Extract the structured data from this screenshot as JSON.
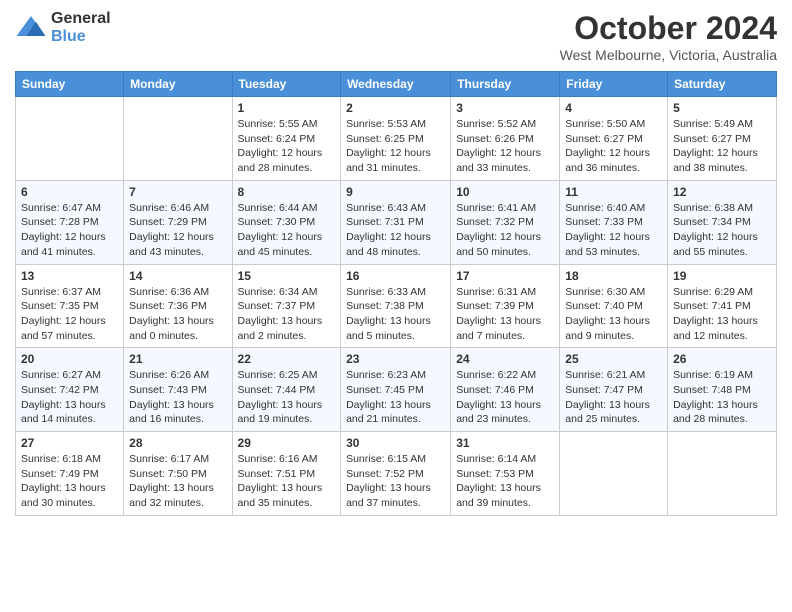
{
  "logo": {
    "general": "General",
    "blue": "Blue"
  },
  "title": "October 2024",
  "subtitle": "West Melbourne, Victoria, Australia",
  "days_of_week": [
    "Sunday",
    "Monday",
    "Tuesday",
    "Wednesday",
    "Thursday",
    "Friday",
    "Saturday"
  ],
  "weeks": [
    [
      {
        "day": "",
        "info": ""
      },
      {
        "day": "",
        "info": ""
      },
      {
        "day": "1",
        "info": "Sunrise: 5:55 AM\nSunset: 6:24 PM\nDaylight: 12 hours and 28 minutes."
      },
      {
        "day": "2",
        "info": "Sunrise: 5:53 AM\nSunset: 6:25 PM\nDaylight: 12 hours and 31 minutes."
      },
      {
        "day": "3",
        "info": "Sunrise: 5:52 AM\nSunset: 6:26 PM\nDaylight: 12 hours and 33 minutes."
      },
      {
        "day": "4",
        "info": "Sunrise: 5:50 AM\nSunset: 6:27 PM\nDaylight: 12 hours and 36 minutes."
      },
      {
        "day": "5",
        "info": "Sunrise: 5:49 AM\nSunset: 6:27 PM\nDaylight: 12 hours and 38 minutes."
      }
    ],
    [
      {
        "day": "6",
        "info": "Sunrise: 6:47 AM\nSunset: 7:28 PM\nDaylight: 12 hours and 41 minutes."
      },
      {
        "day": "7",
        "info": "Sunrise: 6:46 AM\nSunset: 7:29 PM\nDaylight: 12 hours and 43 minutes."
      },
      {
        "day": "8",
        "info": "Sunrise: 6:44 AM\nSunset: 7:30 PM\nDaylight: 12 hours and 45 minutes."
      },
      {
        "day": "9",
        "info": "Sunrise: 6:43 AM\nSunset: 7:31 PM\nDaylight: 12 hours and 48 minutes."
      },
      {
        "day": "10",
        "info": "Sunrise: 6:41 AM\nSunset: 7:32 PM\nDaylight: 12 hours and 50 minutes."
      },
      {
        "day": "11",
        "info": "Sunrise: 6:40 AM\nSunset: 7:33 PM\nDaylight: 12 hours and 53 minutes."
      },
      {
        "day": "12",
        "info": "Sunrise: 6:38 AM\nSunset: 7:34 PM\nDaylight: 12 hours and 55 minutes."
      }
    ],
    [
      {
        "day": "13",
        "info": "Sunrise: 6:37 AM\nSunset: 7:35 PM\nDaylight: 12 hours and 57 minutes."
      },
      {
        "day": "14",
        "info": "Sunrise: 6:36 AM\nSunset: 7:36 PM\nDaylight: 13 hours and 0 minutes."
      },
      {
        "day": "15",
        "info": "Sunrise: 6:34 AM\nSunset: 7:37 PM\nDaylight: 13 hours and 2 minutes."
      },
      {
        "day": "16",
        "info": "Sunrise: 6:33 AM\nSunset: 7:38 PM\nDaylight: 13 hours and 5 minutes."
      },
      {
        "day": "17",
        "info": "Sunrise: 6:31 AM\nSunset: 7:39 PM\nDaylight: 13 hours and 7 minutes."
      },
      {
        "day": "18",
        "info": "Sunrise: 6:30 AM\nSunset: 7:40 PM\nDaylight: 13 hours and 9 minutes."
      },
      {
        "day": "19",
        "info": "Sunrise: 6:29 AM\nSunset: 7:41 PM\nDaylight: 13 hours and 12 minutes."
      }
    ],
    [
      {
        "day": "20",
        "info": "Sunrise: 6:27 AM\nSunset: 7:42 PM\nDaylight: 13 hours and 14 minutes."
      },
      {
        "day": "21",
        "info": "Sunrise: 6:26 AM\nSunset: 7:43 PM\nDaylight: 13 hours and 16 minutes."
      },
      {
        "day": "22",
        "info": "Sunrise: 6:25 AM\nSunset: 7:44 PM\nDaylight: 13 hours and 19 minutes."
      },
      {
        "day": "23",
        "info": "Sunrise: 6:23 AM\nSunset: 7:45 PM\nDaylight: 13 hours and 21 minutes."
      },
      {
        "day": "24",
        "info": "Sunrise: 6:22 AM\nSunset: 7:46 PM\nDaylight: 13 hours and 23 minutes."
      },
      {
        "day": "25",
        "info": "Sunrise: 6:21 AM\nSunset: 7:47 PM\nDaylight: 13 hours and 25 minutes."
      },
      {
        "day": "26",
        "info": "Sunrise: 6:19 AM\nSunset: 7:48 PM\nDaylight: 13 hours and 28 minutes."
      }
    ],
    [
      {
        "day": "27",
        "info": "Sunrise: 6:18 AM\nSunset: 7:49 PM\nDaylight: 13 hours and 30 minutes."
      },
      {
        "day": "28",
        "info": "Sunrise: 6:17 AM\nSunset: 7:50 PM\nDaylight: 13 hours and 32 minutes."
      },
      {
        "day": "29",
        "info": "Sunrise: 6:16 AM\nSunset: 7:51 PM\nDaylight: 13 hours and 35 minutes."
      },
      {
        "day": "30",
        "info": "Sunrise: 6:15 AM\nSunset: 7:52 PM\nDaylight: 13 hours and 37 minutes."
      },
      {
        "day": "31",
        "info": "Sunrise: 6:14 AM\nSunset: 7:53 PM\nDaylight: 13 hours and 39 minutes."
      },
      {
        "day": "",
        "info": ""
      },
      {
        "day": "",
        "info": ""
      }
    ]
  ]
}
